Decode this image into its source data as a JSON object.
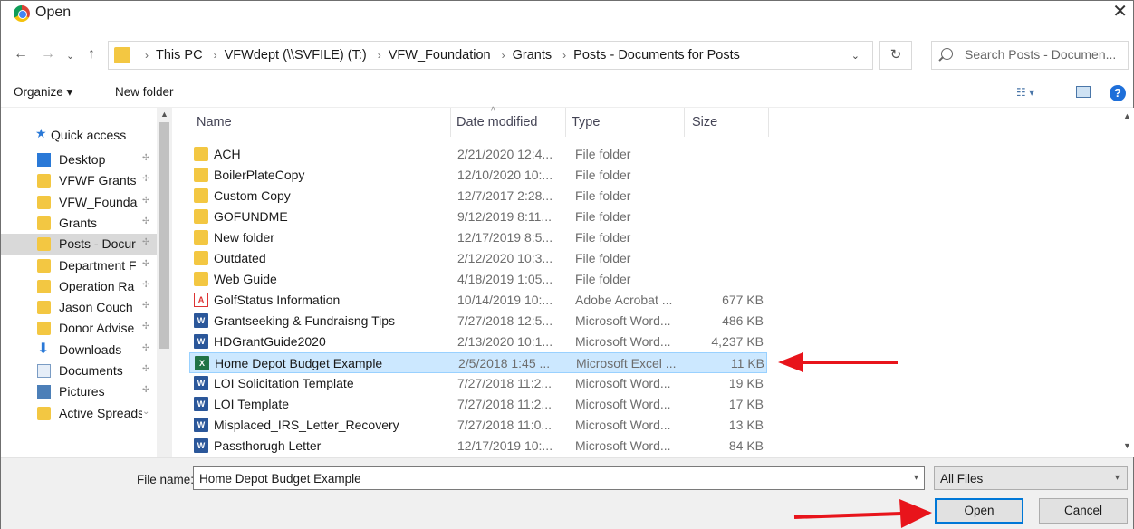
{
  "window": {
    "title": "Open",
    "close_glyph": "✕"
  },
  "nav": {
    "back": "←",
    "forward": "→",
    "recent": "⌄",
    "up": "↑",
    "breadcrumbs": [
      "This PC",
      "VFWdept (\\\\SVFILE) (T:)",
      "VFW_Foundation",
      "Grants",
      "Posts - Documents for Posts"
    ],
    "separator": "›",
    "refresh": "↻",
    "search_placeholder": "Search Posts - Documen..."
  },
  "toolbar": {
    "organize": "Organize ▾",
    "new_folder": "New folder",
    "help": "?"
  },
  "sidebar": {
    "quick_access": "Quick access",
    "items": [
      {
        "label": "Desktop",
        "icon": "desktop-icon"
      },
      {
        "label": "VFWF Grants",
        "icon": "folder-icon"
      },
      {
        "label": "VFW_Founda",
        "icon": "folder-icon"
      },
      {
        "label": "Grants",
        "icon": "folder-icon"
      },
      {
        "label": "Posts - Docur",
        "icon": "folder-icon",
        "selected": true
      },
      {
        "label": "Department F",
        "icon": "folder-icon"
      },
      {
        "label": "Operation Ra",
        "icon": "folder-icon"
      },
      {
        "label": "Jason Couch",
        "icon": "folder-icon"
      },
      {
        "label": "Donor Advise",
        "icon": "folder-icon"
      },
      {
        "label": "Downloads",
        "icon": "downloads-icon"
      },
      {
        "label": "Documents",
        "icon": "documents-icon"
      },
      {
        "label": "Pictures",
        "icon": "pictures-icon"
      },
      {
        "label": "Active Spreadsh",
        "icon": "folder-icon"
      }
    ]
  },
  "columns": {
    "name": "Name",
    "date": "Date modified",
    "type": "Type",
    "size": "Size"
  },
  "files": [
    {
      "name": "ACH",
      "date": "2/21/2020 12:4...",
      "type": "File folder",
      "size": "",
      "kind": "folder"
    },
    {
      "name": "BoilerPlateCopy",
      "date": "12/10/2020 10:...",
      "type": "File folder",
      "size": "",
      "kind": "folder"
    },
    {
      "name": "Custom Copy",
      "date": "12/7/2017 2:28...",
      "type": "File folder",
      "size": "",
      "kind": "folder"
    },
    {
      "name": "GOFUNDME",
      "date": "9/12/2019 8:11...",
      "type": "File folder",
      "size": "",
      "kind": "folder"
    },
    {
      "name": "New folder",
      "date": "12/17/2019 8:5...",
      "type": "File folder",
      "size": "",
      "kind": "folder"
    },
    {
      "name": "Outdated",
      "date": "2/12/2020 10:3...",
      "type": "File folder",
      "size": "",
      "kind": "folder"
    },
    {
      "name": "Web Guide",
      "date": "4/18/2019 1:05...",
      "type": "File folder",
      "size": "",
      "kind": "folder"
    },
    {
      "name": "GolfStatus Information",
      "date": "10/14/2019 10:...",
      "type": "Adobe Acrobat ...",
      "size": "677 KB",
      "kind": "pdf"
    },
    {
      "name": "Grantseeking & Fundraisng Tips",
      "date": "7/27/2018 12:5...",
      "type": "Microsoft Word...",
      "size": "486 KB",
      "kind": "word"
    },
    {
      "name": "HDGrantGuide2020",
      "date": "2/13/2020 10:1...",
      "type": "Microsoft Word...",
      "size": "4,237 KB",
      "kind": "word"
    },
    {
      "name": "Home Depot Budget Example",
      "date": "2/5/2018 1:45 ...",
      "type": "Microsoft Excel ...",
      "size": "11 KB",
      "kind": "excel",
      "selected": true
    },
    {
      "name": "LOI Solicitation Template",
      "date": "7/27/2018 11:2...",
      "type": "Microsoft Word...",
      "size": "19 KB",
      "kind": "word"
    },
    {
      "name": "LOI Template",
      "date": "7/27/2018 11:2...",
      "type": "Microsoft Word...",
      "size": "17 KB",
      "kind": "word"
    },
    {
      "name": "Misplaced_IRS_Letter_Recovery",
      "date": "7/27/2018 11:0...",
      "type": "Microsoft Word...",
      "size": "13 KB",
      "kind": "word"
    },
    {
      "name": "Passthorugh Letter",
      "date": "12/17/2019 10:...",
      "type": "Microsoft Word...",
      "size": "84 KB",
      "kind": "word"
    }
  ],
  "footer": {
    "file_name_label": "File name:",
    "file_name_value": "Home Depot Budget Example",
    "filter": "All Files",
    "open": "Open",
    "cancel": "Cancel"
  },
  "colors": {
    "accent": "#0078d7",
    "selection": "#cce8ff",
    "annotation_arrow": "#e8141b"
  }
}
